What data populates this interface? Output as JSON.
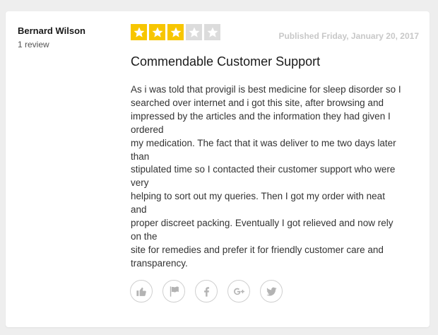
{
  "review": {
    "author_name": "Bernard Wilson",
    "author_review_count": "1 review",
    "rating": 3,
    "rating_max": 5,
    "published": "Published Friday, January 20, 2017",
    "title": "Commendable Customer Support",
    "body_lines": [
      "As i was told that provigil is best medicine for sleep disorder so I",
      "searched over internet and i got this site, after browsing and",
      "impressed by the articles and the information they had given I",
      "ordered",
      "my medication. The fact that it was deliver to me two days later",
      "than",
      "stipulated time so I contacted their customer support who were",
      "very",
      "helping to sort out my queries. Then I got my order with neat",
      "and",
      "proper discreet packing. Eventually I got relieved and now rely",
      "on the",
      "site for remedies and prefer it for friendly customer care and",
      "transparency."
    ]
  },
  "actions": [
    {
      "icon": "thumbs-up-icon"
    },
    {
      "icon": "flag-icon"
    },
    {
      "icon": "facebook-icon"
    },
    {
      "icon": "google-plus-icon"
    },
    {
      "icon": "twitter-icon"
    }
  ],
  "colors": {
    "star_filled": "#f7c600",
    "star_empty": "#dcdcdc",
    "icon_gray": "#b3b3b3"
  }
}
